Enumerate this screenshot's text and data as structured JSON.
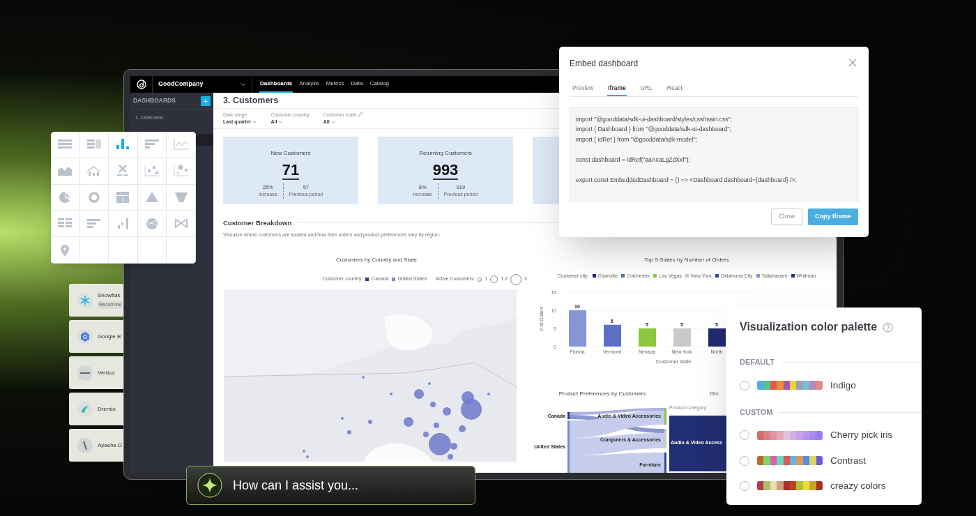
{
  "app": {
    "org": "GoodCompany",
    "nav": [
      {
        "label": "Dashboards",
        "selected": true
      },
      {
        "label": "Analyze",
        "selected": false
      },
      {
        "label": "Metrics",
        "selected": false
      },
      {
        "label": "Data",
        "selected": false
      },
      {
        "label": "Catalog",
        "selected": false
      }
    ],
    "sidebar": {
      "heading": "DASHBOARDS",
      "add": "+",
      "items": [
        {
          "label": "1. Overview",
          "selected": false
        }
      ]
    },
    "title": "3. Customers",
    "filters": [
      {
        "label": "Date range",
        "value": "Last quarter",
        "linked": false
      },
      {
        "label": "Customer country",
        "value": "All",
        "linked": false
      },
      {
        "label": "Customer state",
        "value": "All",
        "linked": true
      }
    ],
    "kpis": [
      {
        "title": "New Customers",
        "value": "71",
        "change": "25%",
        "change_label": "Increase",
        "previous": "57",
        "previous_label": "Previous period"
      },
      {
        "title": "Returning Customers",
        "value": "993",
        "change": "8%",
        "change_label": "Increase",
        "previous": "919",
        "previous_label": "Previous period"
      }
    ],
    "section": {
      "title": "Customer Breakdown",
      "description": "Visualize where customers are located and how their orders and product preferences vary by region."
    },
    "map_chart": {
      "title": "Customers by Country and State",
      "legend_country_label": "Customer country:",
      "countries": [
        {
          "name": "Canada",
          "color": "#2e3a87"
        },
        {
          "name": "United States",
          "color": "#7b8ad0"
        }
      ],
      "legend_size_label": "Active Customers:",
      "sizes": [
        "1",
        "1.2",
        "3"
      ]
    },
    "bar_chart": {
      "legend_label": "Customer city:",
      "chart_data": {
        "type": "bar",
        "title": "Top 5 States by Number of Orders",
        "xlabel": "Customer state",
        "ylabel": "# of Orders",
        "categories": [
          "Florida",
          "Vermont",
          "Nevada",
          "New York",
          "North"
        ],
        "stacked": true,
        "data_labels": true,
        "legend": "top",
        "yticks": [
          0,
          5,
          10,
          15
        ],
        "ylim": [
          0,
          15
        ],
        "series": [
          {
            "name": "Charlotte",
            "color": "#1f2a6e",
            "values": [
              null,
              null,
              null,
              null,
              5
            ]
          },
          {
            "name": "Colchester",
            "color": "#5d6fc4",
            "values": [
              null,
              6,
              null,
              null,
              null
            ]
          },
          {
            "name": "Las Vegas",
            "color": "#8dc63f",
            "values": [
              null,
              null,
              5,
              null,
              null
            ]
          },
          {
            "name": "New York",
            "color": "#c9c9c9",
            "values": [
              null,
              null,
              null,
              5,
              null
            ]
          },
          {
            "name": "Oklahoma City",
            "color": "#34479a",
            "values": [
              null,
              null,
              null,
              null,
              null
            ]
          },
          {
            "name": "Tallahassee",
            "color": "#8595d6",
            "values": [
              10,
              null,
              null,
              null,
              null
            ]
          },
          {
            "name": "Whitman",
            "color": "#263383",
            "values": [
              null,
              null,
              null,
              null,
              null
            ]
          }
        ]
      }
    },
    "sankey": {
      "title": "Product Preferences by Customers",
      "sources": [
        "Canada",
        "United States"
      ],
      "targets": [
        "Audio & Video Accessories",
        "Computers & Accessories",
        "Furniture"
      ]
    },
    "cut_chart": {
      "title": "Orc",
      "legend_label": "Product category:",
      "block_label": "Audio & Video Access"
    }
  },
  "chart_picker": [
    {
      "kind": "table",
      "selected": false
    },
    {
      "kind": "headline-table",
      "selected": false
    },
    {
      "kind": "column",
      "selected": true
    },
    {
      "kind": "bar",
      "selected": false
    },
    {
      "kind": "line",
      "selected": false
    },
    {
      "kind": "area",
      "selected": false
    },
    {
      "kind": "combo",
      "selected": false
    },
    {
      "kind": "headline",
      "selected": false
    },
    {
      "kind": "scatter",
      "selected": false
    },
    {
      "kind": "bubble",
      "selected": false
    },
    {
      "kind": "pie",
      "selected": false
    },
    {
      "kind": "donut",
      "selected": false
    },
    {
      "kind": "treemap",
      "selected": false
    },
    {
      "kind": "pyramid",
      "selected": false
    },
    {
      "kind": "funnel",
      "selected": false
    },
    {
      "kind": "pivot",
      "selected": false
    },
    {
      "kind": "bullet",
      "selected": false
    },
    {
      "kind": "waterfall",
      "selected": false
    },
    {
      "kind": "wheel",
      "selected": false
    },
    {
      "kind": "sankey",
      "selected": false
    },
    {
      "kind": "geo",
      "selected": false
    }
  ],
  "connectors": [
    {
      "kind": "snowflake",
      "name": "Snowflak",
      "badge": "Recomme"
    },
    {
      "kind": "bigquery",
      "name": "Google B"
    },
    {
      "kind": "vertica",
      "name": "Vertica"
    },
    {
      "kind": "dremio",
      "name": "Dremio"
    },
    {
      "kind": "apache",
      "name": "Apache D"
    }
  ],
  "embed_dialog": {
    "title": "Embed dashboard",
    "tabs": [
      {
        "label": "Preview",
        "selected": false
      },
      {
        "label": "Iframe",
        "selected": true
      },
      {
        "label": "URL",
        "selected": false
      },
      {
        "label": "React",
        "selected": false
      }
    ],
    "code_blocks": [
      [
        "import \"@gooddata/sdk-ui-dashboard/styles/css/main.css\";",
        "import { Dashboard } from \"@gooddata/sdk-ui-dashboard\";",
        "import { idRef } from \"@gooddata/sdk-model\";"
      ],
      [
        "const dashboard = idRef(\"aaAxaLgZdXxf\");"
      ],
      [
        "export const EmbeddedDashboard = () => <Dashboard dashboard={dashboard} />;"
      ]
    ],
    "buttons": [
      {
        "label": "Close",
        "primary": false
      },
      {
        "label": "Copy Iframe",
        "primary": true
      }
    ]
  },
  "palette_panel": {
    "title": "Visualization color palette",
    "sections": [
      {
        "heading": "DEFAULT",
        "palettes": [
          {
            "name": "Indigo",
            "selected": false,
            "swatches": [
              {
                "color": "#4cb0e0"
              },
              {
                "color": "#5bbf8a"
              },
              {
                "color": "#de5c4b"
              },
              {
                "color": "#ef8c34"
              },
              {
                "color": "#a25cae"
              },
              {
                "color": "#f1d03e"
              },
              {
                "color": "#9aa4b0"
              },
              {
                "color": "#74c0dd"
              },
              {
                "color": "#b48cb5"
              },
              {
                "color": "#e9897d"
              }
            ]
          }
        ]
      },
      {
        "heading": "CUSTOM",
        "palettes": [
          {
            "name": "Cherry pick iris",
            "selected": false,
            "swatches": [
              {
                "color": "#d96b6b"
              },
              {
                "color": "#dc8084"
              },
              {
                "color": "#df969e"
              },
              {
                "color": "#e2aab8"
              },
              {
                "color": "#e0c4d8"
              },
              {
                "color": "#d5b0e6"
              },
              {
                "color": "#c6a2ea"
              },
              {
                "color": "#b896ec"
              },
              {
                "color": "#a88aee"
              },
              {
                "color": "#9a7ef0"
              }
            ]
          },
          {
            "name": "Contrast",
            "selected": false,
            "swatches": [
              {
                "color": "#b86a2c"
              },
              {
                "color": "#7fd26e"
              },
              {
                "color": "#d862a8"
              },
              {
                "color": "#6fd5c0"
              },
              {
                "color": "#d75c5c"
              },
              {
                "color": "#67b3e0"
              },
              {
                "color": "#d59c5c"
              },
              {
                "color": "#5f8bdc"
              },
              {
                "color": "#d9d56a"
              },
              {
                "color": "#6c5ad6"
              }
            ]
          },
          {
            "name": "creazy colors",
            "selected": false,
            "swatches": [
              {
                "color": "#b9394d"
              },
              {
                "color": "#a6c26a"
              },
              {
                "color": "#f0dcb2"
              },
              {
                "color": "#c7a07c"
              },
              {
                "color": "#a3302c"
              },
              {
                "color": "#c2401f"
              },
              {
                "color": "#a8c43c"
              },
              {
                "color": "#f1d83c"
              },
              {
                "color": "#c8a530"
              },
              {
                "color": "#a8341e"
              }
            ]
          }
        ]
      }
    ]
  },
  "assistant": {
    "placeholder": "How can I assist you..."
  }
}
